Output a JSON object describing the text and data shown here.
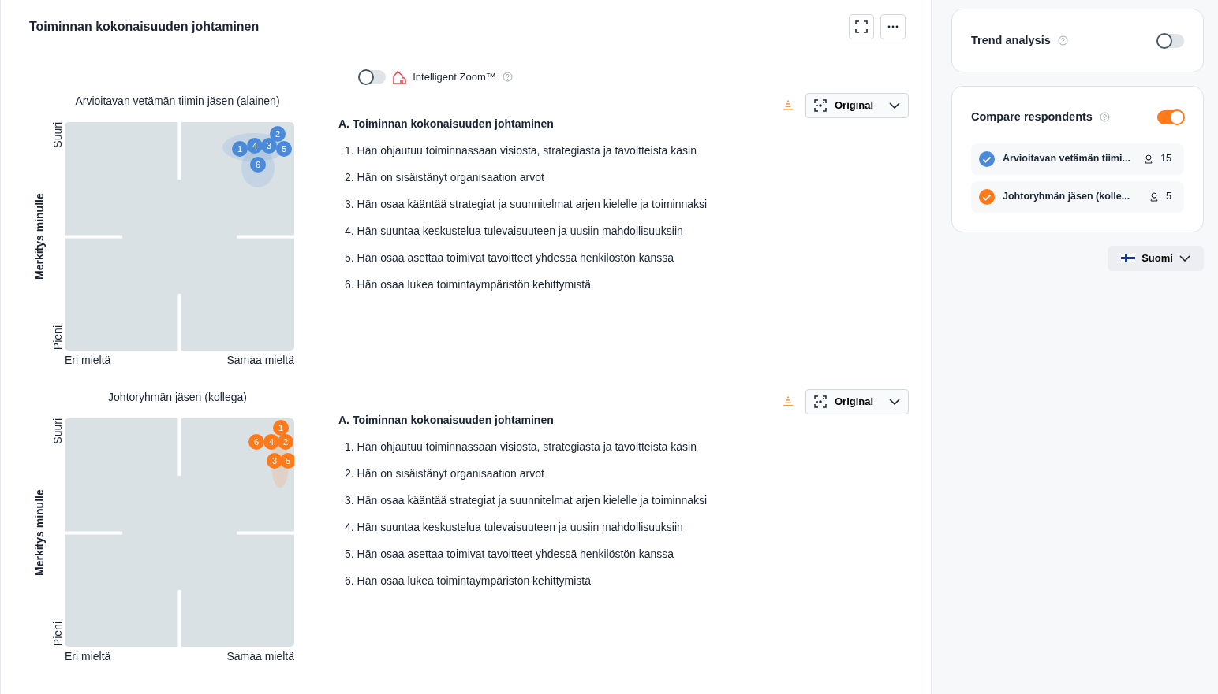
{
  "header": {
    "title": "Toiminnan kokonaisuuden johtaminen",
    "buttons": [
      {
        "kind": "fullscreen"
      },
      {
        "kind": "more"
      }
    ]
  },
  "intelligent_zoom": {
    "on": false,
    "label": "Intelligent Zoom™"
  },
  "panels": [
    {
      "group": "Arvioitavan vetämän tiimin jäsen (alainen)",
      "color": "#4a8ad8",
      "y_axis": "Merkitys minulle",
      "y_high": "Suuri",
      "y_low": "Pieni",
      "x_low": "Eri mieltä",
      "x_high": "Samaa mieltä",
      "points": [
        {
          "label": "2"
        },
        {
          "label": "1"
        },
        {
          "label": "4"
        },
        {
          "label": "3"
        },
        {
          "label": "5"
        },
        {
          "label": "6"
        }
      ],
      "view": "Original",
      "heading": "A. Toiminnan kokonaisuuden johtaminen",
      "items": [
        "1. Hän ohjautuu toiminnassaan visiosta, strategiasta ja tavoitteista käsin",
        "2. Hän on sisäistänyt organisaation arvot",
        "3. Hän osaa kääntää strategiat ja suunnitelmat arjen kielelle ja toiminnaksi",
        "4. Hän suuntaa keskustelua tulevaisuuteen ja uusiin mahdollisuuksiin",
        "5. Hän osaa asettaa toimivat tavoitteet yhdessä henkilöstön kanssa",
        "6. Hän osaa lukea toimintaympäristön kehittymistä"
      ]
    },
    {
      "group": "Johtoryhmän jäsen (kollega)",
      "color": "#ff7a1a",
      "y_axis": "Merkitys minulle",
      "y_high": "Suuri",
      "y_low": "Pieni",
      "x_low": "Eri mieltä",
      "x_high": "Samaa mieltä",
      "points": [
        {
          "label": "1"
        },
        {
          "label": "6"
        },
        {
          "label": "4"
        },
        {
          "label": "2"
        },
        {
          "label": "3"
        },
        {
          "label": "5"
        }
      ],
      "view": "Original",
      "heading": "A. Toiminnan kokonaisuuden johtaminen",
      "items": [
        "1. Hän ohjautuu toiminnassaan visiosta, strategiasta ja tavoitteista käsin",
        "2. Hän on sisäistänyt organisaation arvot",
        "3. Hän osaa kääntää strategiat ja suunnitelmat arjen kielelle ja toiminnaksi",
        "4. Hän suuntaa keskustelua tulevaisuuteen ja uusiin mahdollisuuksiin",
        "5. Hän osaa asettaa toimivat tavoitteet yhdessä henkilöstön kanssa",
        "6. Hän osaa lukea toimintaympäristön kehittymistä"
      ]
    }
  ],
  "sidebar": {
    "trend": {
      "label": "Trend analysis",
      "on": false
    },
    "compare": {
      "label": "Compare respondents",
      "on": true,
      "groups": [
        {
          "name": "Arvioitavan vetämän tiimi...",
          "count": "15",
          "checked": true,
          "color": "#4a8ad8"
        },
        {
          "name": "Johtoryhmän jäsen (kolle...",
          "count": "5",
          "checked": true,
          "color": "#ff7a1a"
        }
      ]
    },
    "language": "Suomi"
  }
}
